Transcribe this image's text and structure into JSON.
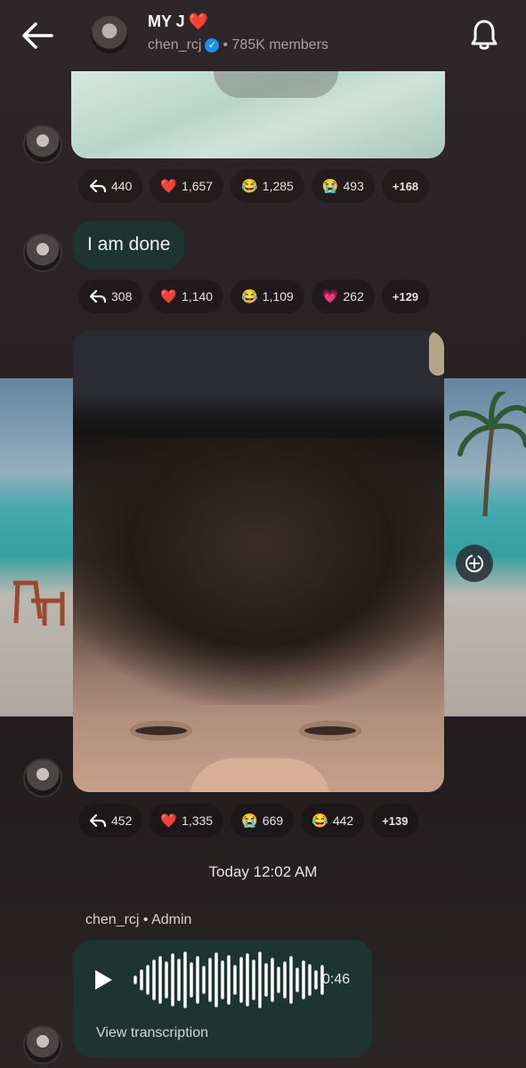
{
  "header": {
    "title": "MY J",
    "title_emoji": "❤️",
    "handle": "chen_rcj",
    "members": "• 785K members"
  },
  "messages": [
    {
      "type": "image",
      "reactions": [
        {
          "icon": "reply-icon",
          "emoji": "",
          "count": "440"
        },
        {
          "icon": "heart-emoji",
          "emoji": "❤️",
          "count": "1,657"
        },
        {
          "icon": "laugh-emoji",
          "emoji": "😂",
          "count": "1,285"
        },
        {
          "icon": "cry-emoji",
          "emoji": "😭",
          "count": "493"
        },
        {
          "icon": "more",
          "emoji": "",
          "count": "+168"
        }
      ]
    },
    {
      "type": "text",
      "text": "I am done",
      "reactions": [
        {
          "icon": "reply-icon",
          "emoji": "",
          "count": "308"
        },
        {
          "icon": "heart-emoji",
          "emoji": "❤️",
          "count": "1,140"
        },
        {
          "icon": "laugh-emoji",
          "emoji": "😂",
          "count": "1,109"
        },
        {
          "icon": "pink-heart-emoji",
          "emoji": "💗",
          "count": "262"
        },
        {
          "icon": "more",
          "emoji": "",
          "count": "+129"
        }
      ]
    },
    {
      "type": "image",
      "reactions": [
        {
          "icon": "reply-icon",
          "emoji": "",
          "count": "452"
        },
        {
          "icon": "heart-emoji",
          "emoji": "❤️",
          "count": "1,335"
        },
        {
          "icon": "cry-emoji",
          "emoji": "😭",
          "count": "669"
        },
        {
          "icon": "laugh-emoji",
          "emoji": "😂",
          "count": "442"
        },
        {
          "icon": "more",
          "emoji": "",
          "count": "+139"
        }
      ]
    }
  ],
  "divider": "Today 12:02 AM",
  "voice": {
    "sender": "chen_rcj • Admin",
    "duration": "0:46",
    "transcription_label": "View transcription"
  },
  "colors": {
    "bubble": "#1e3430",
    "verified": "#1a8ef0",
    "heart": "#e0243b"
  }
}
